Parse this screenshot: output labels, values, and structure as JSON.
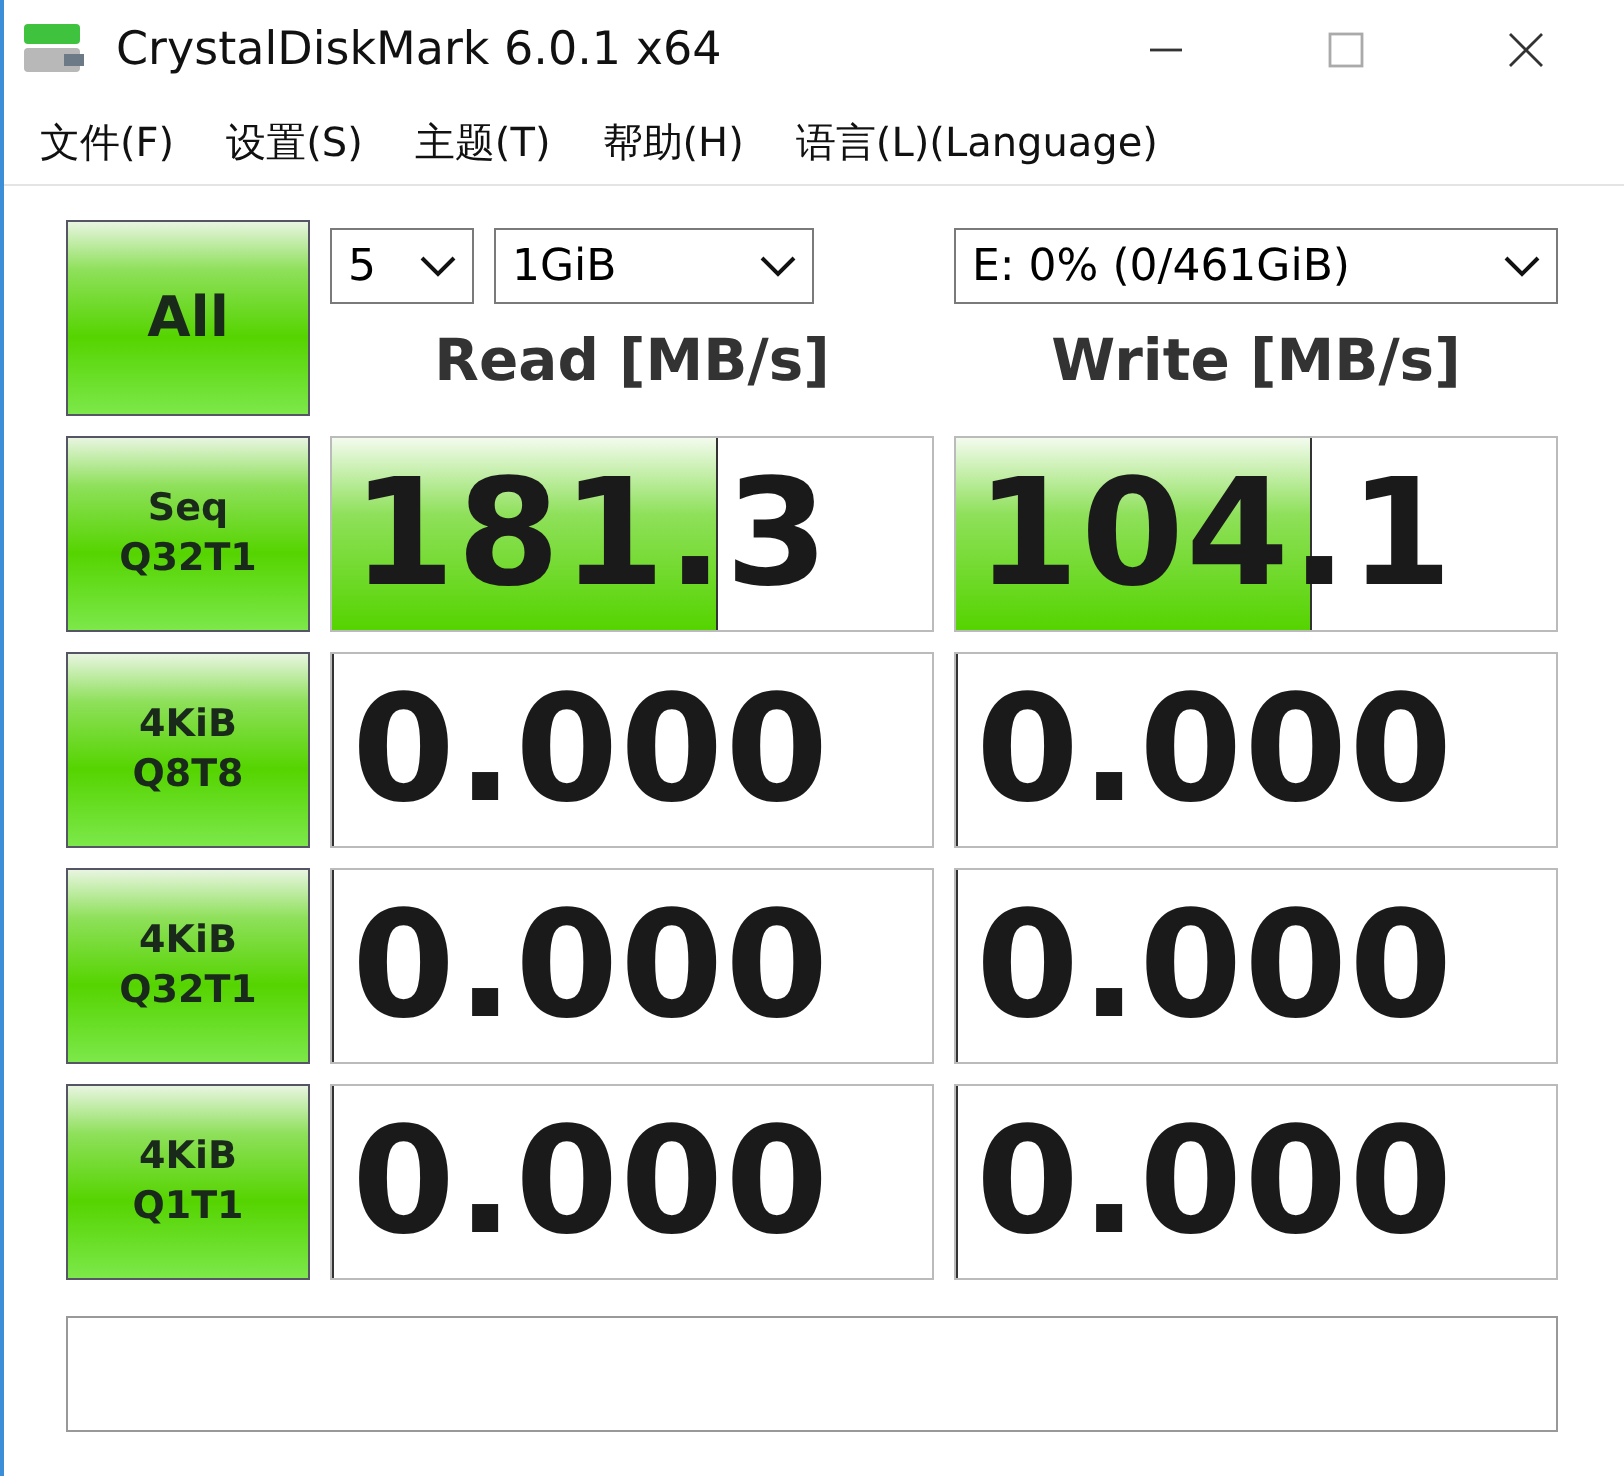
{
  "window": {
    "title": "CrystalDiskMark 6.0.1 x64"
  },
  "menu": [
    "文件(F)",
    "设置(S)",
    "主题(T)",
    "帮助(H)",
    "语言(L)(Language)"
  ],
  "all_button": "All",
  "selectors": {
    "count": "5",
    "size": "1GiB",
    "drive": "E: 0% (0/461GiB)"
  },
  "headers": {
    "read": "Read [MB/s]",
    "write": "Write [MB/s]"
  },
  "tests": [
    {
      "label": [
        "Seq",
        "Q32T1"
      ],
      "read": {
        "value": "181.3",
        "level": 0.64
      },
      "write": {
        "value": "104.1",
        "level": 0.59
      }
    },
    {
      "label": [
        "4KiB",
        "Q8T8"
      ],
      "read": {
        "value": "0.000",
        "level": 0
      },
      "write": {
        "value": "0.000",
        "level": 0
      }
    },
    {
      "label": [
        "4KiB",
        "Q32T1"
      ],
      "read": {
        "value": "0.000",
        "level": 0
      },
      "write": {
        "value": "0.000",
        "level": 0
      }
    },
    {
      "label": [
        "4KiB",
        "Q1T1"
      ],
      "read": {
        "value": "0.000",
        "level": 0
      },
      "write": {
        "value": "0.000",
        "level": 0
      }
    }
  ]
}
